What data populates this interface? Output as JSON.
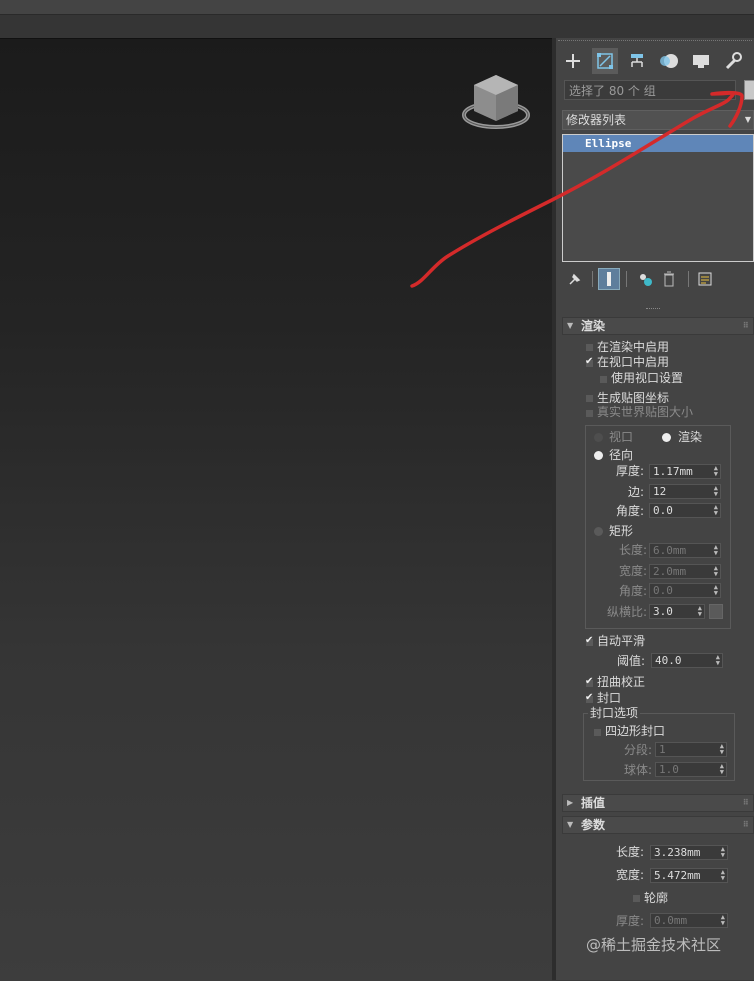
{
  "command_panel": {
    "tabs": [
      "create-icon",
      "modify-icon",
      "hierarchy-icon",
      "motion-icon",
      "display-icon",
      "utilities-icon"
    ],
    "selection_info": "选择了 80 个 组",
    "modifier_list": "修改器列表",
    "stack_item": "Ellipse"
  },
  "rendering": {
    "title": "渲染",
    "enable_in_renderer": "在渲染中启用",
    "enable_in_viewport": "在视口中启用",
    "use_viewport_settings": "使用视口设置",
    "generate_mapping": "生成贴图坐标",
    "real_world_map_size": "真实世界贴图大小",
    "viewport_label": "视口",
    "render_label": "渲染",
    "radial_label": "径向",
    "thickness_label": "厚度:",
    "thickness_value": "1.17mm",
    "sides_label": "边:",
    "sides_value": "12",
    "angle_label": "角度:",
    "angle_value": "0.0",
    "rectangular_label": "矩形",
    "rect_length_label": "长度:",
    "rect_length_value": "6.0mm",
    "rect_width_label": "宽度:",
    "rect_width_value": "2.0mm",
    "rect_angle_label": "角度:",
    "rect_angle_value": "0.0",
    "aspect_label": "纵横比:",
    "aspect_value": "3.0",
    "auto_smooth": "自动平滑",
    "threshold_label": "阈值:",
    "threshold_value": "40.0",
    "twist_correction": "扭曲校正",
    "cap": "封口",
    "cap_options": "封口选项",
    "quad_cap": "四边形封口",
    "segments_label": "分段:",
    "segments_value": "1",
    "sphere_label": "球体:",
    "sphere_value": "1.0"
  },
  "interpolation": {
    "title": "插值"
  },
  "parameters": {
    "title": "参数",
    "length_label": "长度:",
    "length_value": "3.238mm",
    "width_label": "宽度:",
    "width_value": "5.472mm",
    "outline_label": "轮廓",
    "thickness_label": "厚度:",
    "thickness_value": "0.0mm"
  },
  "watermark": "@稀土掘金技术社区",
  "colors": {
    "annotation_stroke": "#d42a2a",
    "stack_highlight": "#5f86b8"
  }
}
